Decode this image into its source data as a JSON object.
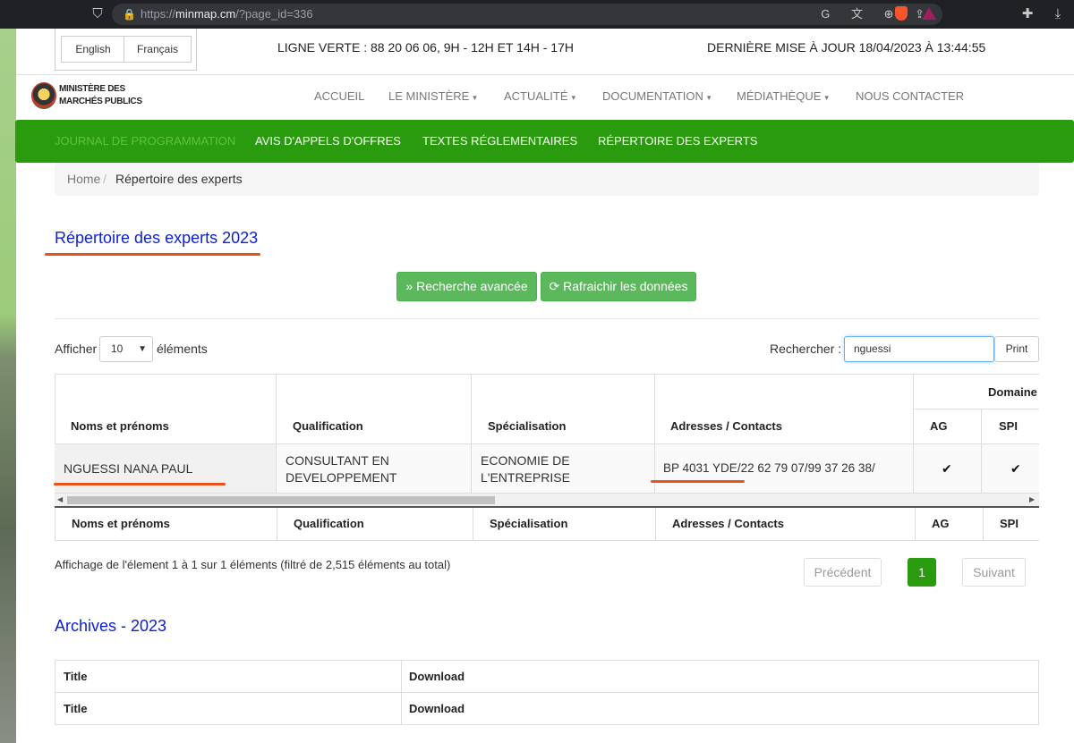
{
  "browser": {
    "url_prefix": "https://",
    "url_domain": "minmap.cm",
    "url_path": "/?page_id=336"
  },
  "topbar": {
    "lang_en": "English",
    "lang_fr": "Français",
    "green_line": "LIGNE VERTE : 88 20 06 06, 9H - 12H ET 14H - 17H",
    "last_update": "DERNIÈRE MISE À JOUR 18/04/2023 À 13:44:55"
  },
  "logo": {
    "line1": "MINISTÈRE DES",
    "line2": "MARCHÉS PUBLICS"
  },
  "nav": {
    "items": [
      "ACCUEIL",
      "LE MINISTÈRE",
      "ACTUALITÉ",
      "DOCUMENTATION",
      "MÉDIATHÈQUE",
      "NOUS CONTACTER"
    ]
  },
  "green_menu": {
    "items": [
      "JOURNAL DE PROGRAMMATION",
      "AVIS D'APPELS D'OFFRES",
      "TEXTES RÉGLEMENTAIRES",
      "RÉPERTOIRE DES EXPERTS"
    ]
  },
  "breadcrumb": {
    "home": "Home",
    "separator": "/",
    "current": "Répertoire des experts"
  },
  "page": {
    "title": "Répertoire des experts 2023",
    "btn_advanced": "Recherche avancée",
    "btn_refresh": "Rafraichir les données",
    "show_label": "Afficher",
    "show_value": "10",
    "show_suffix": "éléments",
    "search_label": "Rechercher :",
    "search_value": "nguessi",
    "print_label": "Print"
  },
  "table": {
    "group_header": "Domaine",
    "headers": [
      "Noms et prénoms",
      "Qualification",
      "Spécialisation",
      "Adresses / Contacts",
      "AG",
      "SPI"
    ],
    "row": {
      "name": "NGUESSI NANA PAUL",
      "qualification_1": "CONSULTANT EN",
      "qualification_2": "DEVELOPPEMENT",
      "specialisation_1": "ECONOMIE DE",
      "specialisation_2": "L'ENTREPRISE",
      "contact": "BP 4031 YDE/22 62 79 07/99 37 26 38/",
      "ag": "✔",
      "spi": "✔"
    }
  },
  "footer_info": {
    "info": "Affichage de l'élement 1 à 1 sur 1 éléments (filtré de 2,515 éléments au total)",
    "prev": "Précédent",
    "page": "1",
    "next": "Suivant"
  },
  "archives": {
    "title": "Archives - 2023",
    "rows": [
      {
        "title": "Title",
        "download": "Download"
      },
      {
        "title": "Title",
        "download": "Download"
      }
    ]
  },
  "colors": {
    "green": "#2a9a0e",
    "link_blue": "#0c20d6",
    "annotation_red": "#e8531c"
  }
}
